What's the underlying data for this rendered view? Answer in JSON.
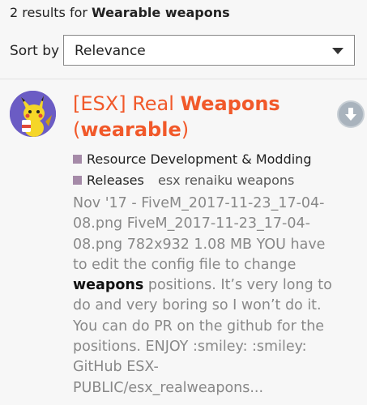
{
  "search": {
    "result_count": "2 results for",
    "query": "Wearable weapons"
  },
  "sort": {
    "label": "Sort by",
    "selected": "Relevance"
  },
  "result": {
    "title_prefix": "[ESX] Real ",
    "title_highlight_1": "Weapons",
    "title_open_paren": "(",
    "title_highlight_2": "wearable",
    "title_close_paren": ")",
    "category": "Resource Development & Modding",
    "subcategory": "Releases",
    "tags": "esx renaiku weapons",
    "excerpt_before": "Nov '17 - FiveM_2017-11-23_17-04-08.png FiveM_2017-11-23_17-04-08.png 782x932 1.08 MB YOU have to edit the config file to change ",
    "excerpt_highlight": "weapons",
    "excerpt_after": " positions. It’s very long to do and very boring so I won’t do it. You can do PR on the github for the positions. ENJOY :smiley: :smiley: GitHub ESX-PUBLIC/esx_realweapons..."
  },
  "colors": {
    "title": "#f1592a",
    "category_square": "#a58aa8",
    "avatar_bg": "#6b5cc4"
  },
  "icons": {
    "avatar": "pikachu-avatar-icon",
    "download": "download-arrow-icon",
    "dropdown": "chevron-down-icon"
  }
}
